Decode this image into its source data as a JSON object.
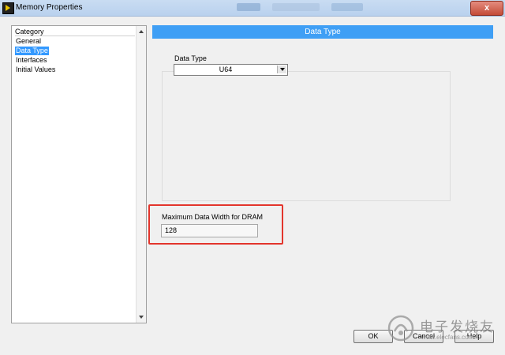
{
  "window": {
    "title": "Memory Properties",
    "close_label": "x"
  },
  "category_panel": {
    "header": "Category",
    "items": [
      "General",
      "Data Type",
      "Interfaces",
      "Initial Values"
    ],
    "selected_index": 1
  },
  "main": {
    "section_title": "Data Type",
    "data_type": {
      "label": "Data Type",
      "value": "U64"
    },
    "dram": {
      "label": "Maximum Data Width for DRAM",
      "value": "128"
    }
  },
  "buttons": {
    "ok": "OK",
    "cancel": "Cancel",
    "help": "Help"
  },
  "watermark": {
    "name": "电子发烧友",
    "url": "www.elecfans.com"
  },
  "colors": {
    "section_header": "#3f9ff5",
    "selection": "#3399ff",
    "highlight_box": "#e3352c"
  }
}
